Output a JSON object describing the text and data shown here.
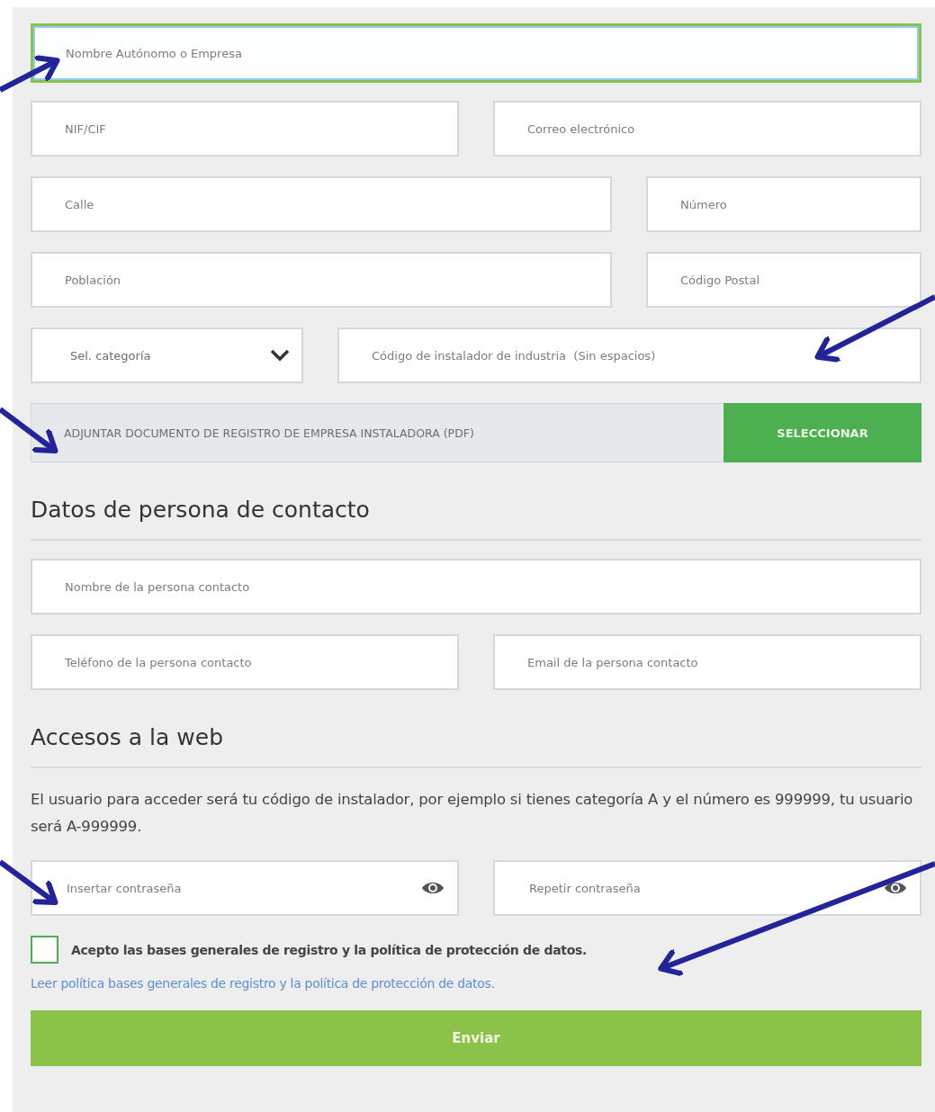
{
  "company": {
    "rows": [
      [
        {
          "kind": "input",
          "placeholder": "Nombre Autónomo o Empresa",
          "focused": true
        }
      ],
      [
        {
          "kind": "input",
          "placeholder": "NIF/CIF",
          "focused": false
        },
        {
          "kind": "input",
          "placeholder": "Correo electrónico",
          "focused": false
        }
      ],
      [
        {
          "kind": "input",
          "placeholder": "Calle",
          "focused": false
        },
        {
          "kind": "input",
          "placeholder": "Número",
          "focused": false
        }
      ],
      [
        {
          "kind": "input",
          "placeholder": "Población",
          "focused": false
        },
        {
          "kind": "input",
          "placeholder": "Código Postal",
          "focused": false
        }
      ],
      [
        {
          "kind": "select",
          "placeholder": "Sel. categoría",
          "focused": false
        },
        {
          "kind": "input",
          "placeholder": "Código de instalador de industria  (Sin espacios)",
          "focused": false
        }
      ]
    ]
  },
  "upload": {
    "label": "ADJUNTAR DOCUMENTO DE REGISTRO DE EMPRESA INSTALADORA (PDF)",
    "button": "SELECCIONAR"
  },
  "contact": {
    "heading": "Datos de persona de contacto",
    "rows": [
      [
        {
          "kind": "input",
          "placeholder": "Nombre de la persona contacto",
          "focused": false
        }
      ],
      [
        {
          "kind": "input",
          "placeholder": "Teléfono de la persona contacto",
          "focused": false
        },
        {
          "kind": "input",
          "placeholder": "Email de la persona contacto",
          "focused": false
        }
      ]
    ]
  },
  "access": {
    "heading": "Accesos a la web",
    "note": "El usuario para acceder será tu código de instalador, por ejemplo si tienes categoría A y el número es 999999, tu usuario será A-999999.",
    "passwords": [
      {
        "placeholder": "Insertar contraseña"
      },
      {
        "placeholder": "Repetir contraseña"
      }
    ]
  },
  "consent": {
    "label": "Acepto las bases generales de registro y la política de protección de datos.",
    "checked": false,
    "link": "Leer política bases generales de registro y la política de protección de datos."
  },
  "submit": "Enviar"
}
